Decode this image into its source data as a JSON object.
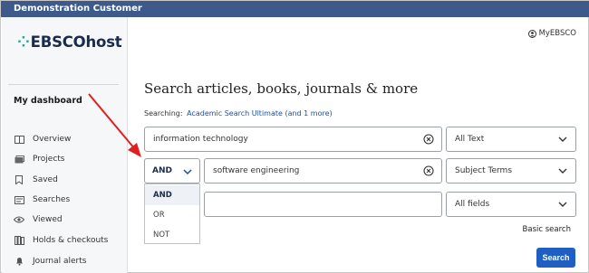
{
  "topbar": {
    "title": "Demonstration Customer"
  },
  "logo": {
    "text": "EBSCOhost"
  },
  "sidebar": {
    "title": "My dashboard",
    "items": [
      {
        "label": "Overview",
        "icon": "overview-icon"
      },
      {
        "label": "Projects",
        "icon": "projects-icon"
      },
      {
        "label": "Saved",
        "icon": "bookmark-icon"
      },
      {
        "label": "Searches",
        "icon": "searches-icon"
      },
      {
        "label": "Viewed",
        "icon": "eye-icon"
      },
      {
        "label": "Holds & checkouts",
        "icon": "holds-icon"
      },
      {
        "label": "Journal alerts",
        "icon": "bell-icon"
      }
    ]
  },
  "header": {
    "account_label": "MyEBSCO"
  },
  "main": {
    "heading": "Search articles, books, journals & more",
    "searching_label": "Searching:",
    "searching_link": "Academic Search Ultimate (and 1 more)",
    "rows": [
      {
        "value": "information technology",
        "field": "All Text"
      },
      {
        "operator": "AND",
        "value": "software engineering",
        "field": "Subject Terms"
      },
      {
        "value": "",
        "field": "All fields"
      }
    ],
    "operator_options": [
      "AND",
      "OR",
      "NOT"
    ],
    "basic_search_label": "Basic search",
    "search_button_label": "Search"
  },
  "colors": {
    "topbar": "#3d5a8a",
    "accent": "#1f5fc4",
    "annotation_arrow": "#e02020"
  }
}
